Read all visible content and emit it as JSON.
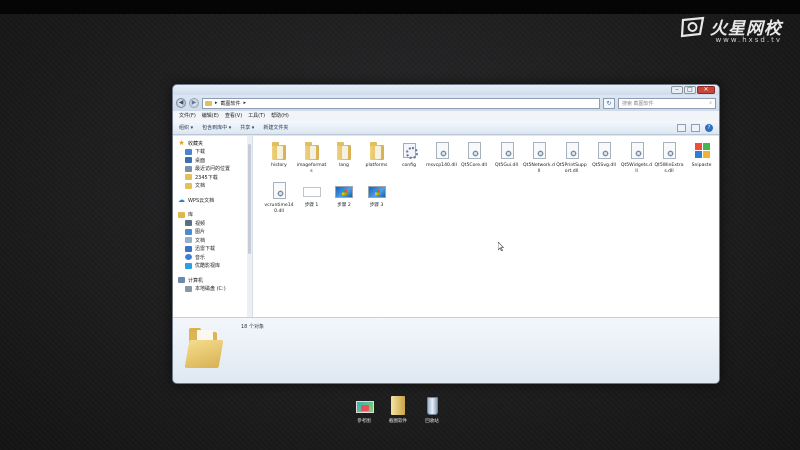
{
  "watermark": {
    "brand": "火星网校",
    "url": "www.hxsd.tv"
  },
  "window": {
    "address": {
      "path": "截图软件",
      "separator": "▸"
    },
    "search": {
      "placeholder": "搜索 截图软件"
    },
    "menu": [
      "文件(F)",
      "编辑(E)",
      "查看(V)",
      "工具(T)",
      "帮助(H)"
    ],
    "toolbar": {
      "organize": "组织 ▾",
      "include": "包含到库中 ▾",
      "share": "共享 ▾",
      "new_folder": "新建文件夹"
    },
    "nav": {
      "favorites": {
        "label": "收藏夹",
        "items": [
          "下载",
          "桌面",
          "最近访问的位置",
          "2345下载",
          "文档"
        ]
      },
      "wps": {
        "label": "WPS云文档"
      },
      "libraries": {
        "label": "库",
        "items": [
          "视频",
          "图片",
          "文档",
          "迅雷下载",
          "音乐",
          "优酷影视库"
        ]
      },
      "computer": {
        "label": "计算机",
        "items": [
          "本地磁盘 (C:)"
        ]
      }
    },
    "files": [
      {
        "name": "history",
        "type": "folder"
      },
      {
        "name": "imageformats",
        "type": "folder"
      },
      {
        "name": "lang",
        "type": "folder"
      },
      {
        "name": "platforms",
        "type": "folder"
      },
      {
        "name": "config",
        "type": "config"
      },
      {
        "name": "msvcp140.dll",
        "type": "dll"
      },
      {
        "name": "Qt5Core.dll",
        "type": "dll"
      },
      {
        "name": "Qt5Gui.dll",
        "type": "dll"
      },
      {
        "name": "Qt5Network.dll",
        "type": "dll"
      },
      {
        "name": "Qt5PrintSupport.dll",
        "type": "dll"
      },
      {
        "name": "Qt5Svg.dll",
        "type": "dll"
      },
      {
        "name": "Qt5Widgets.dll",
        "type": "dll"
      },
      {
        "name": "Qt5WinExtras.dll",
        "type": "dll"
      },
      {
        "name": "Snipaste",
        "type": "app"
      },
      {
        "name": "vcruntime140.dll",
        "type": "dll"
      },
      {
        "name": "步骤 1",
        "type": "image-blank"
      },
      {
        "name": "步骤 2",
        "type": "image-win"
      },
      {
        "name": "步骤 3",
        "type": "image-win"
      }
    ],
    "status": {
      "count": "18 个对象"
    }
  },
  "taskbar": [
    {
      "label": "参考图",
      "icon": "reference-image-icon"
    },
    {
      "label": "截图软件",
      "icon": "folder-icon"
    },
    {
      "label": "回收站",
      "icon": "recycle-bin-icon"
    }
  ]
}
